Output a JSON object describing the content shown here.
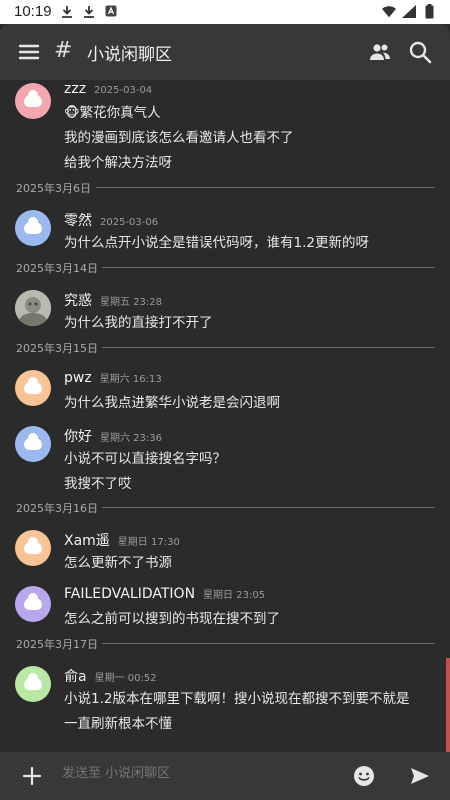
{
  "status": {
    "time": "10:19"
  },
  "channel": {
    "hash": "#",
    "title": "小说闲聊区"
  },
  "input": {
    "placeholder": "发送至 小说闲聊区"
  },
  "messages": [
    {
      "user": "zzz",
      "time": "2025-03-04",
      "avatar_color": "#f4a6ae",
      "lines": [
        "🐵繁花你真气人",
        "我的漫画到底该怎么看邀请人也看不了",
        "给我个解决方法呀"
      ]
    },
    {
      "date": "2025年3月6日"
    },
    {
      "user": "零然",
      "time": "2025-03-06",
      "avatar_color": "#9cb9ef",
      "lines": [
        "为什么点开小说全是错误代码呀，谁有1.2更新的呀"
      ]
    },
    {
      "date": "2025年3月14日"
    },
    {
      "user": "究惑",
      "time": "星期五 23:28",
      "avatar_color": "#bcbcb4",
      "lines": [
        "为什么我的直接打不开了"
      ]
    },
    {
      "date": "2025年3月15日"
    },
    {
      "user": "pwz",
      "time": "星期六 16:13",
      "avatar_color": "#f7c493",
      "lines": [
        "为什么我点进繁华小说老是会闪退啊"
      ]
    },
    {
      "user": "你好",
      "time": "星期六 23:36",
      "avatar_color": "#9cb9ef",
      "lines": [
        "小说不可以直接搜名字吗？",
        "我搜不了哎"
      ]
    },
    {
      "date": "2025年3月16日"
    },
    {
      "user": "Xam遥",
      "time": "星期日 17:30",
      "avatar_color": "#f7c493",
      "lines": [
        "怎么更新不了书源"
      ]
    },
    {
      "user": "FAILEDVALIDATION",
      "time": "星期日 23:05",
      "avatar_color": "#b8a6ef",
      "lines": [
        "怎么之前可以搜到的书现在搜不到了"
      ]
    },
    {
      "date": "2025年3月17日"
    },
    {
      "user": "俞a",
      "time": "星期一 00:52",
      "avatar_color": "#b8e8a4",
      "lines": [
        "小说1.2版本在哪里下载啊！搜小说现在都搜不到要不就是",
        "一直刷新根本不懂"
      ]
    }
  ]
}
